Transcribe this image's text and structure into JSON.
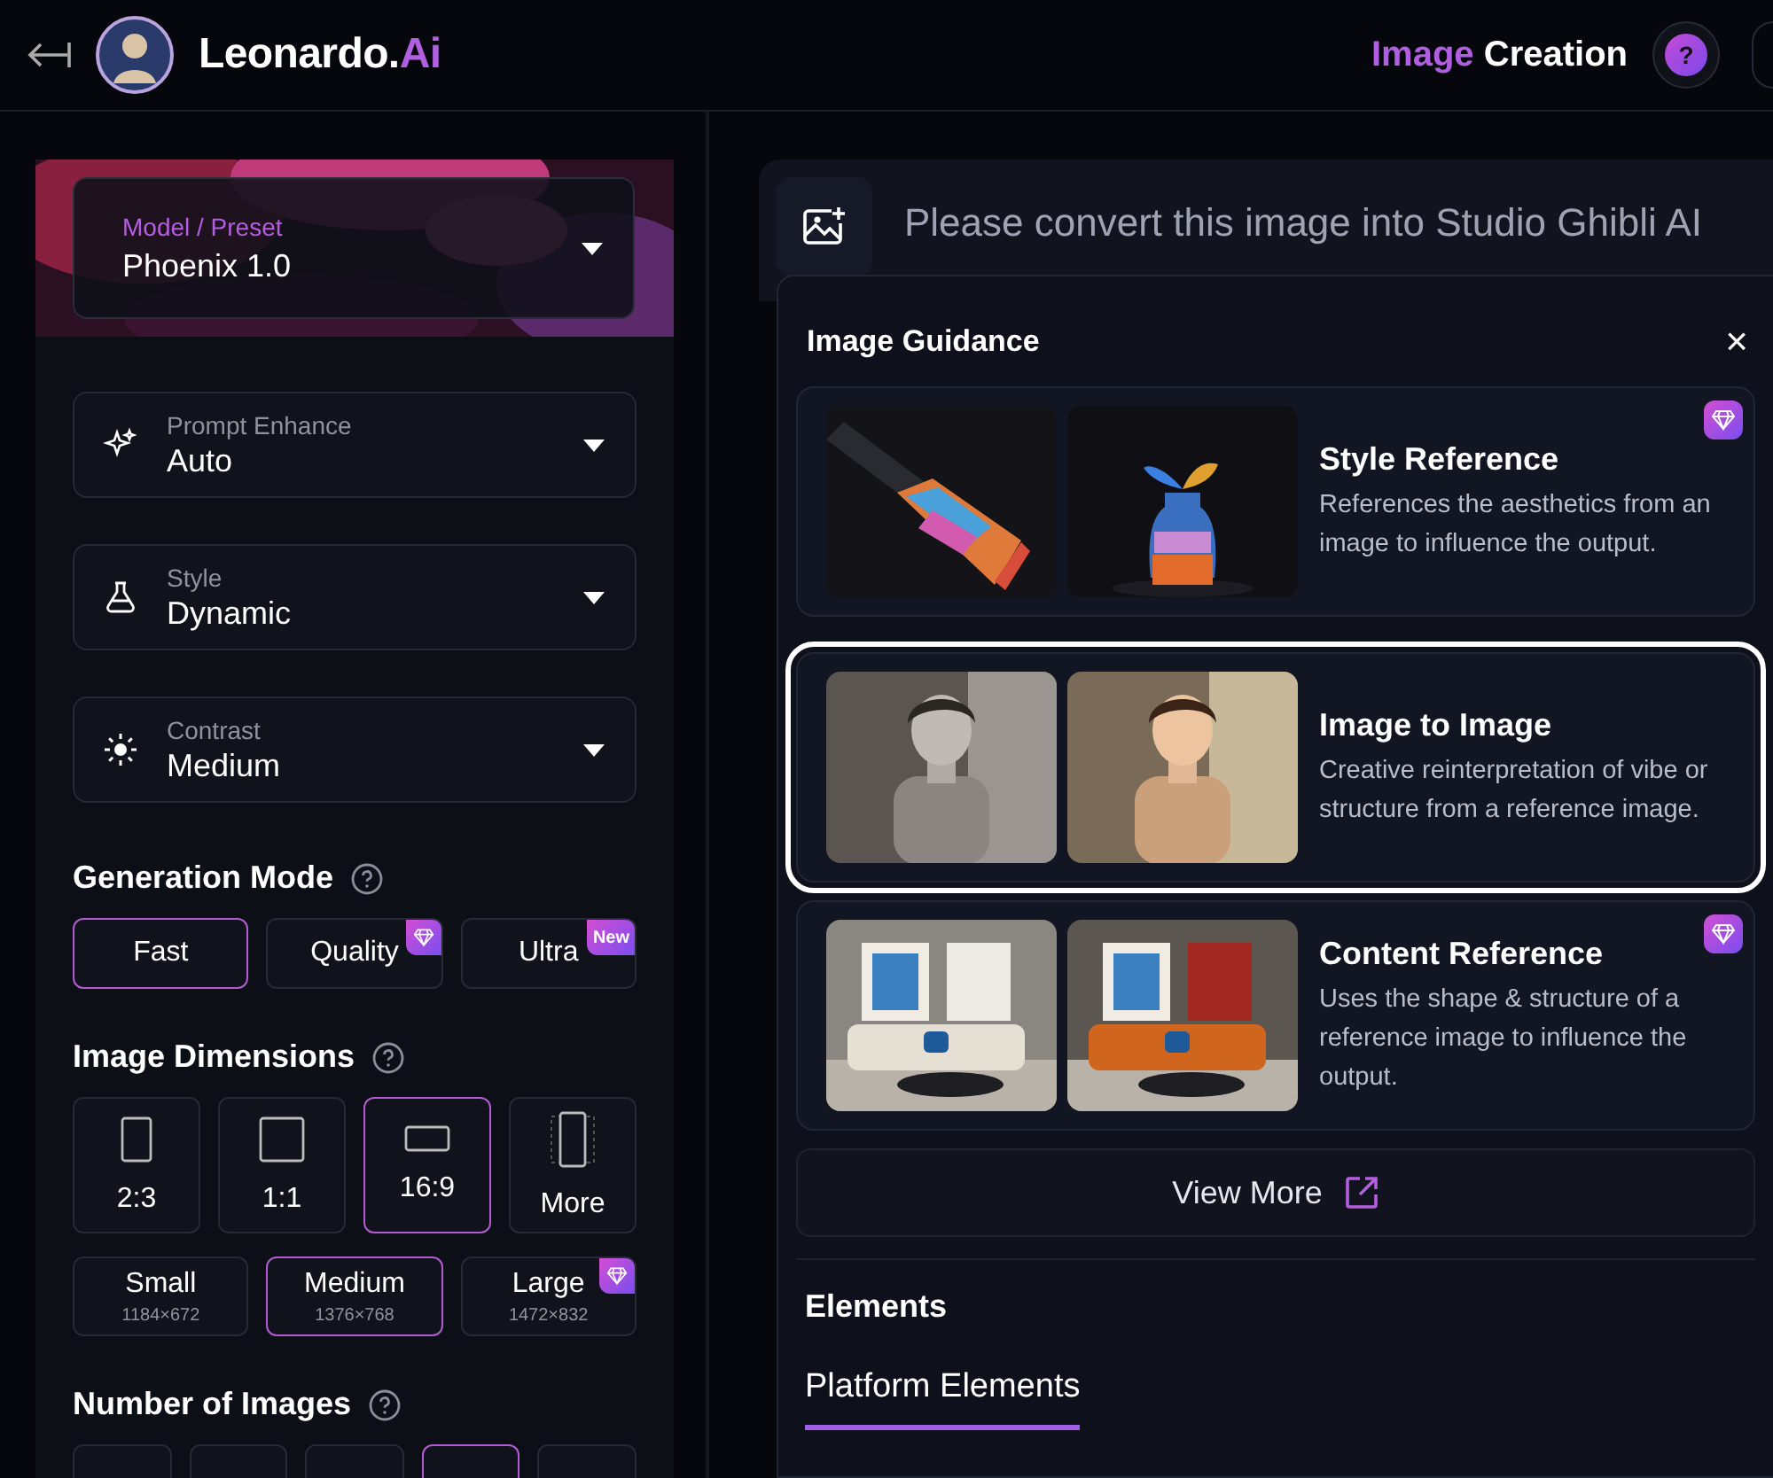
{
  "header": {
    "brand": "Leonardo.",
    "brand_suffix": "Ai",
    "page_accent": "Image",
    "page_title": "Creation",
    "help": "?"
  },
  "sidebar": {
    "model": {
      "label": "Model / Preset",
      "value": "Phoenix 1.0"
    },
    "dropdowns": [
      {
        "kind": "sparkle",
        "label": "Prompt Enhance",
        "value": "Auto"
      },
      {
        "kind": "flask",
        "label": "Style",
        "value": "Dynamic"
      },
      {
        "kind": "sun",
        "label": "Contrast",
        "value": "Medium"
      }
    ],
    "generation_mode": {
      "title": "Generation Mode",
      "options": [
        {
          "label": "Fast",
          "selected": true
        },
        {
          "label": "Quality",
          "selected": false,
          "premium": true
        },
        {
          "label": "Ultra",
          "selected": false,
          "badge": "New"
        }
      ]
    },
    "image_dimensions": {
      "title": "Image Dimensions",
      "ratios": [
        {
          "label": "2:3",
          "kind": "portrait",
          "selected": false
        },
        {
          "label": "1:1",
          "kind": "square",
          "selected": false
        },
        {
          "label": "16:9",
          "kind": "landscape",
          "selected": true
        },
        {
          "label": "More",
          "kind": "more",
          "selected": false
        }
      ],
      "sizes": [
        {
          "label": "Small",
          "detail": "1184×672",
          "selected": false
        },
        {
          "label": "Medium",
          "detail": "1376×768",
          "selected": true
        },
        {
          "label": "Large",
          "detail": "1472×832",
          "selected": false,
          "premium": true
        }
      ]
    },
    "number_of_images": {
      "title": "Number of Images",
      "options": [
        {
          "selected": false
        },
        {
          "selected": false
        },
        {
          "selected": false
        },
        {
          "selected": true
        },
        {
          "selected": false
        }
      ]
    }
  },
  "prompt": {
    "placeholder": "Please convert this image into Studio Ghibli AI"
  },
  "image_guidance": {
    "title": "Image Guidance",
    "close": "×",
    "options": [
      {
        "title": "Style Reference",
        "description": "References the aesthetics from an image to influence the output.",
        "premium": true,
        "highlighted": false
      },
      {
        "title": "Image to Image",
        "description": "Creative reinterpretation of vibe or structure from a reference image.",
        "premium": false,
        "highlighted": true
      },
      {
        "title": "Content Reference",
        "description": "Uses the shape & structure of a reference image to influence the output.",
        "premium": true,
        "highlighted": false
      }
    ],
    "view_more": "View More",
    "elements_title": "Elements",
    "tabs": [
      {
        "label": "Platform Elements",
        "selected": true
      }
    ]
  }
}
